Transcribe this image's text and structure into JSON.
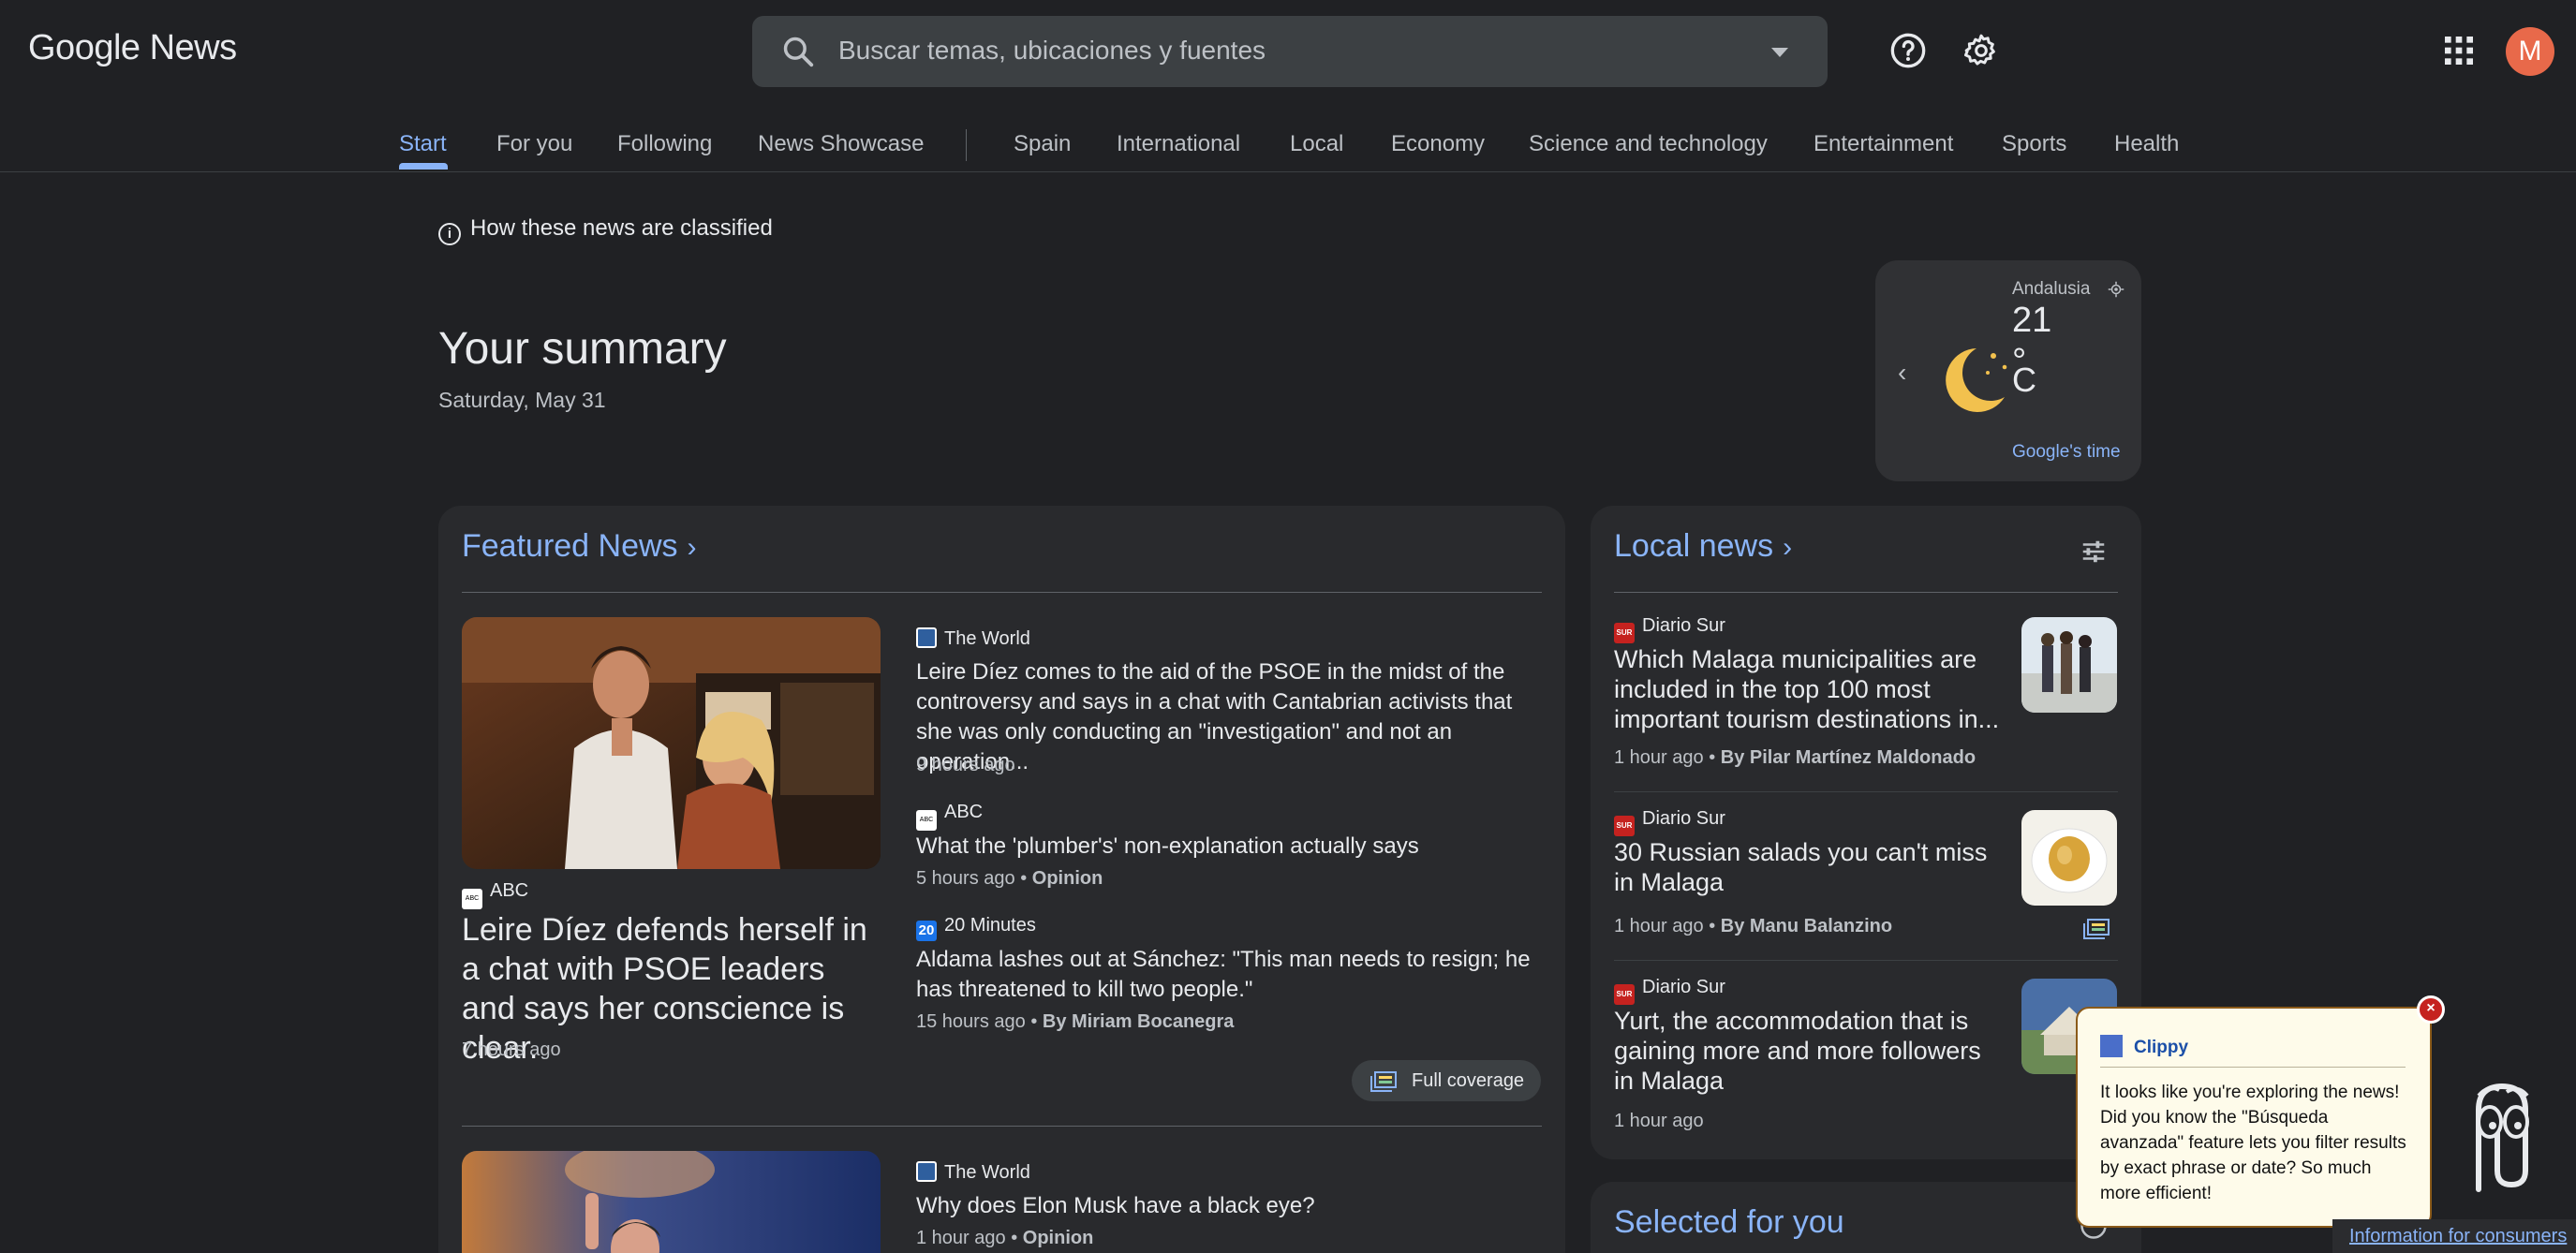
{
  "header": {
    "logo_google": "Google",
    "logo_news": "News",
    "search_placeholder": "Buscar temas, ubicaciones y fuentes",
    "avatar_initial": "M"
  },
  "nav": {
    "tabs": [
      "Start",
      "For you",
      "Following",
      "News Showcase",
      "Spain",
      "International",
      "Local",
      "Economy",
      "Science and technology",
      "Entertainment",
      "Sports",
      "Health"
    ],
    "active": "Start"
  },
  "classified_link": "How these news are classified",
  "summary": {
    "title": "Your summary",
    "date": "Saturday, May 31"
  },
  "weather": {
    "location": "Andalusia",
    "temp": "21",
    "degree": "°",
    "unit": "C",
    "link": "Google's time"
  },
  "featured": {
    "title": "Featured News",
    "hero": {
      "source": "ABC",
      "headline": "Leire Díez defends herself in a chat with PSOE leaders and says her conscience is clear.",
      "time": "7 hours ago"
    },
    "stories": [
      {
        "source": "The World",
        "headline": "Leire Díez comes to the aid of the PSOE in the midst of the controversy and says in a chat with Cantabrian activists that she was only conducting an \"investigation\" and not an operation...",
        "time": "9 hours ago",
        "extra": ""
      },
      {
        "source": "ABC",
        "headline": "What the 'plumber's' non-explanation actually says",
        "time": "5 hours ago",
        "extra": "Opinion"
      },
      {
        "source": "20 Minutes",
        "headline": "Aldama lashes out at Sánchez: \"This man needs to resign; he has threatened to kill two people.\"",
        "time": "15 hours ago",
        "extra": "By Miriam Bocanegra"
      }
    ],
    "full_coverage": "Full coverage",
    "second": {
      "source": "The World",
      "headline": "Why does Elon Musk have a black eye?",
      "time": "1 hour ago",
      "extra": "Opinion"
    }
  },
  "local": {
    "title": "Local news",
    "items": [
      {
        "source": "Diario Sur",
        "headline": "Which Malaga municipalities are included in the top 100 most important tourism destinations in...",
        "time": "1 hour ago",
        "extra": "By Pilar Martínez Maldonado"
      },
      {
        "source": "Diario Sur",
        "headline": "30 Russian salads you can't miss in Malaga",
        "time": "1 hour ago",
        "extra": "By Manu Balanzino"
      },
      {
        "source": "Diario Sur",
        "headline": "Yurt, the accommodation that is gaining more and more followers in Malaga",
        "time": "1 hour ago",
        "extra": ""
      }
    ]
  },
  "selected": {
    "title": "Selected for you"
  },
  "clippy": {
    "title": "Clippy",
    "message": "It looks like you're exploring the news! Did you know the \"Búsqueda avanzada\" feature lets you filter results by exact phrase or date? So much more efficient!",
    "close": "×"
  },
  "footer_link": "Information for consumers",
  "bullet": " • ",
  "badge_20": "20",
  "badge_abc": "ABC",
  "badge_sur": "SUR",
  "colors": {
    "accent": "#8ab4f8",
    "background": "#202124",
    "card": "#292a2d"
  }
}
